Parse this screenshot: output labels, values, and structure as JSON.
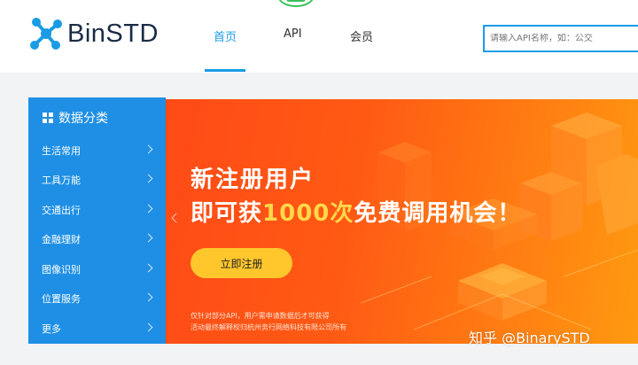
{
  "brand": {
    "name": "BinSTD",
    "accent": "#1a9be6",
    "logo_color": "#1a9be6"
  },
  "nav": {
    "items": [
      {
        "label": "首页",
        "active": true
      },
      {
        "label": "API",
        "active": false
      },
      {
        "label": "会员",
        "active": false
      }
    ]
  },
  "search": {
    "placeholder": "请输入API名称，如：公交"
  },
  "sidebar": {
    "title": "数据分类",
    "items": [
      {
        "label": "生活常用"
      },
      {
        "label": "工具万能"
      },
      {
        "label": "交通出行"
      },
      {
        "label": "金融理财"
      },
      {
        "label": "图像识别"
      },
      {
        "label": "位置服务"
      },
      {
        "label": "更多"
      }
    ]
  },
  "banner": {
    "line1": "新注册用户",
    "line2_prefix": "即可获",
    "line2_highlight": "1000次",
    "line2_suffix": "免费调用机会！",
    "button_label": "立即注册",
    "note1": "仅针对部分API，用户需申请数据后才可获得",
    "note2": "活动最终解释权归杭州务行网络科技有限公司所有"
  },
  "watermark": "知乎 @BinarySTD"
}
